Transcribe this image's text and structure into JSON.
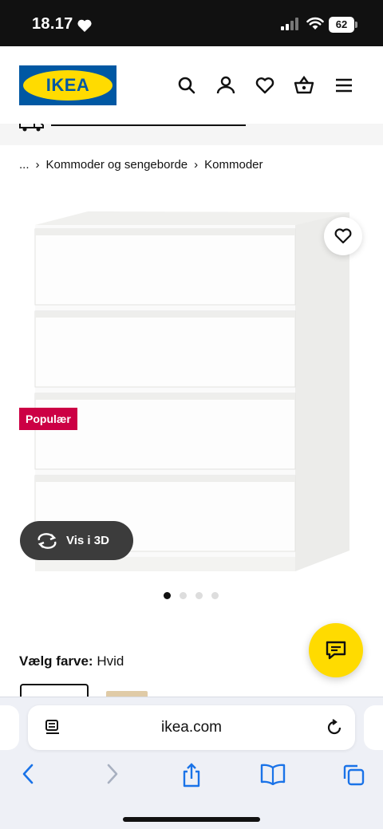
{
  "status_bar": {
    "time": "18.17",
    "battery": "62",
    "icons": [
      "heart-icon",
      "signal-icon",
      "wifi-icon",
      "battery-icon"
    ]
  },
  "header": {
    "logo": "IKEA",
    "icons": [
      "search-icon",
      "account-icon",
      "favourites-icon",
      "basket-icon",
      "menu-icon"
    ],
    "colors": {
      "brand_blue": "#0058a3",
      "brand_yellow": "#ffdb00"
    }
  },
  "breadcrumb": {
    "items": [
      "...",
      "Kommoder og sengeborde",
      "Kommoder"
    ],
    "separator": "›"
  },
  "product": {
    "badge": "Populær",
    "badge_color": "#cc0044",
    "view_3d_label": "Vis i 3D",
    "gallery": {
      "image_count": 4,
      "active_index": 0
    },
    "color_prompt": "Vælg farve:",
    "color_value": "Hvid"
  },
  "chat": {
    "icon": "chat-icon",
    "color": "#ffdb00"
  },
  "browser": {
    "url": "ikea.com",
    "toolbar": [
      "back-icon",
      "forward-icon",
      "share-icon",
      "bookmarks-icon",
      "tabs-icon"
    ],
    "accent": "#1a73e8"
  }
}
